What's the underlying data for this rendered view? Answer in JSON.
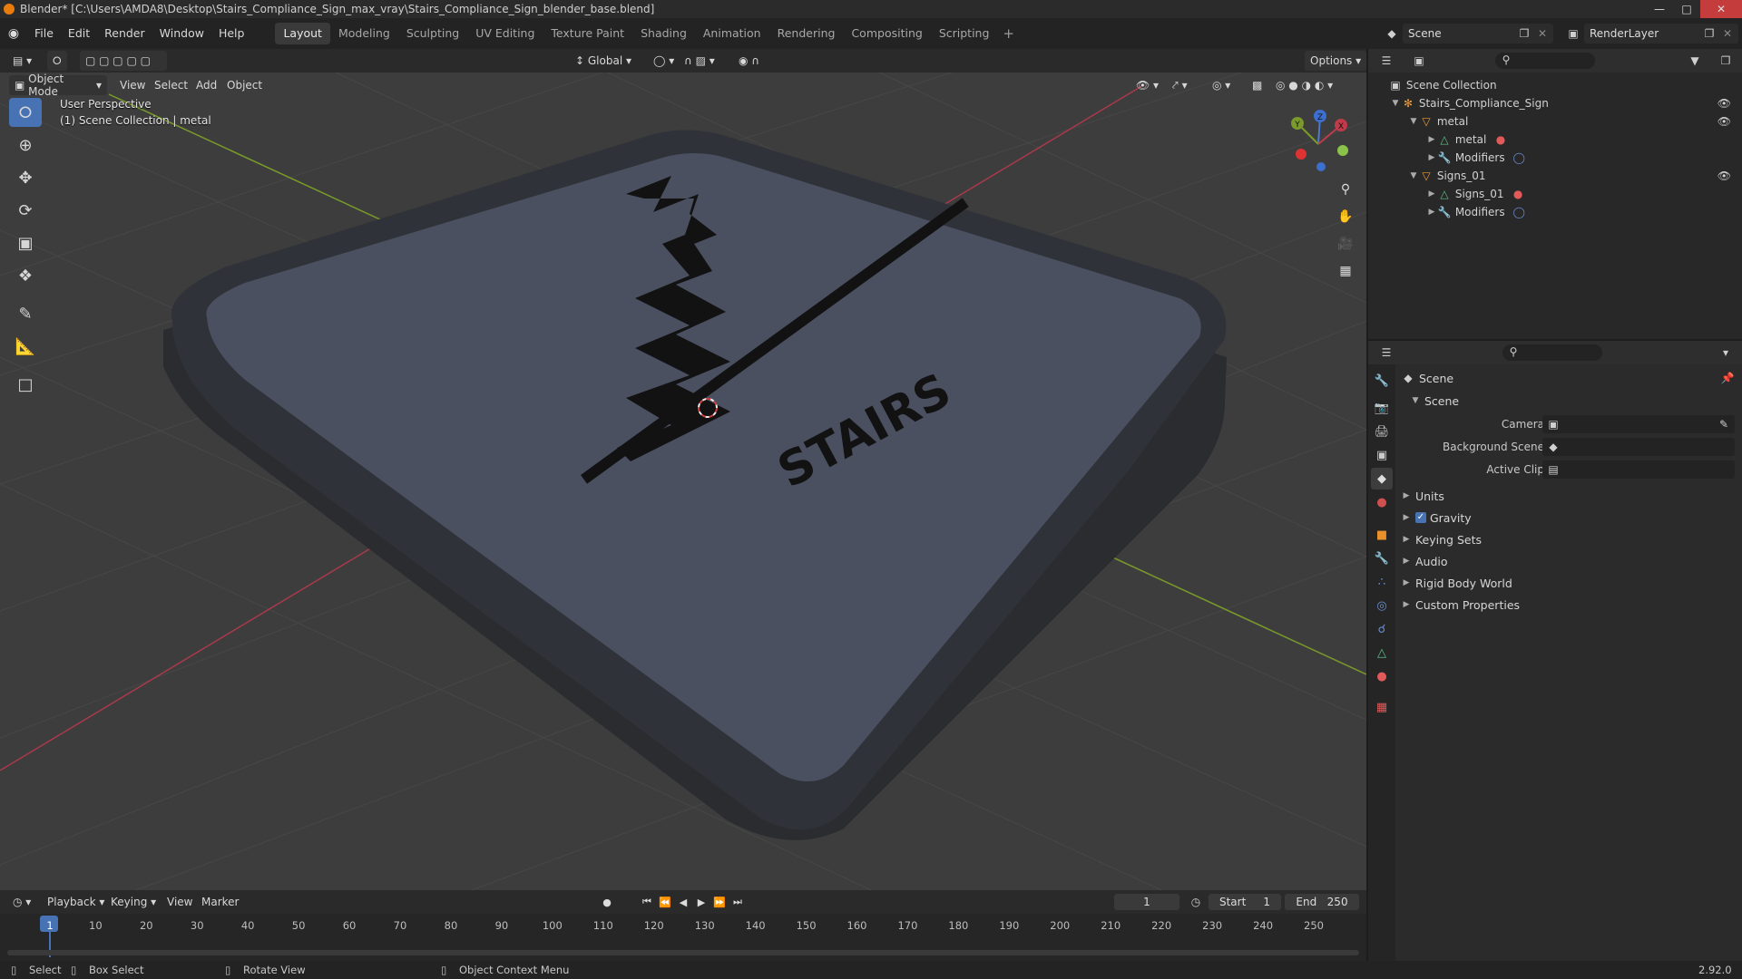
{
  "window": {
    "title": "Blender* [C:\\Users\\AMDA8\\Desktop\\Stairs_Compliance_Sign_max_vray\\Stairs_Compliance_Sign_blender_base.blend]",
    "minimize": "—",
    "maximize": "□",
    "close": "✕"
  },
  "menu": {
    "items": [
      "File",
      "Edit",
      "Render",
      "Window",
      "Help"
    ],
    "workspaces": [
      "Layout",
      "Modeling",
      "Sculpting",
      "UV Editing",
      "Texture Paint",
      "Shading",
      "Animation",
      "Rendering",
      "Compositing",
      "Scripting"
    ],
    "active_workspace": "Layout",
    "add_tab": "+",
    "scene": "Scene",
    "render_layer": "RenderLayer"
  },
  "viewport_header": {
    "transform_orientation": "Global",
    "options": "Options",
    "mode": "Object Mode",
    "menus": [
      "View",
      "Select",
      "Add",
      "Object"
    ]
  },
  "viewport": {
    "perspective": "User Perspective",
    "collection_info": "(1) Scene Collection | metal",
    "sign_text": "STAIRS",
    "gizmo_axes": [
      "X",
      "Y",
      "Z"
    ],
    "colors": {
      "background": "#3d3d3d",
      "grid": "#474747",
      "x_axis": "#a83a4a",
      "y_axis": "#7a9a2a",
      "sign_face": "#4a5060",
      "sign_rim": "#2e3036",
      "sign_ink": "#121212"
    }
  },
  "outliner": {
    "root": "Scene Collection",
    "items": [
      {
        "label": "Stairs_Compliance_Sign",
        "level": 1
      },
      {
        "label": "metal",
        "level": 2
      },
      {
        "label": "metal",
        "level": 3
      },
      {
        "label": "Modifiers",
        "level": 3
      },
      {
        "label": "Signs_01",
        "level": 2
      },
      {
        "label": "Signs_01",
        "level": 3
      },
      {
        "label": "Modifiers",
        "level": 3
      }
    ]
  },
  "properties": {
    "context": "Scene",
    "panel": "Scene",
    "fields": [
      {
        "label": "Camera",
        "value": ""
      },
      {
        "label": "Background Scene",
        "value": ""
      },
      {
        "label": "Active Clip",
        "value": ""
      }
    ],
    "sections": [
      "Units",
      "Gravity",
      "Keying Sets",
      "Audio",
      "Rigid Body World",
      "Custom Properties"
    ],
    "gravity_checked": true
  },
  "timeline": {
    "menus": [
      "Playback",
      "Keying",
      "View",
      "Marker"
    ],
    "current_frame": "1",
    "start_label": "Start",
    "start": "1",
    "end_label": "End",
    "end": "250",
    "ruler": [
      "1",
      "10",
      "20",
      "30",
      "40",
      "50",
      "60",
      "70",
      "80",
      "90",
      "100",
      "110",
      "120",
      "130",
      "140",
      "150",
      "160",
      "170",
      "180",
      "190",
      "200",
      "210",
      "220",
      "230",
      "240",
      "250"
    ]
  },
  "statusbar": {
    "select": "Select",
    "box_select": "Box Select",
    "rotate_view": "Rotate View",
    "context_menu": "Object Context Menu",
    "version": "2.92.0"
  }
}
